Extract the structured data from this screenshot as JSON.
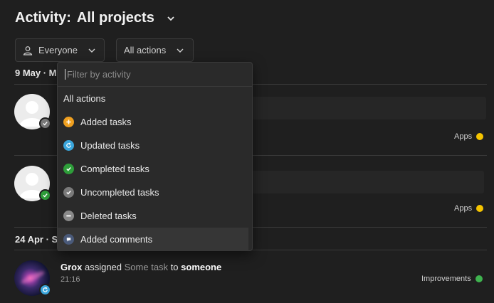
{
  "header": {
    "title_prefix": "Activity:",
    "title_scope": "All projects"
  },
  "filters": {
    "people_label": "Everyone",
    "actions_label": "All actions"
  },
  "sections": [
    {
      "date": "9 May · M"
    },
    {
      "date": "24 Apr · S"
    }
  ],
  "entries": [
    {
      "tag": "Apps",
      "tag_color": "#f5c400"
    },
    {
      "tag": "Apps",
      "tag_color": "#f5c400"
    },
    {
      "user": "Grox",
      "verb": "assigned",
      "task": "Some task",
      "preposition": "to",
      "target": "someone",
      "time": "21:16",
      "tag": "Improvements",
      "tag_color": "#3fb34f"
    }
  ],
  "dropdown": {
    "search_placeholder": "Filter by activity",
    "items": [
      {
        "label": "All actions",
        "icon": "none"
      },
      {
        "label": "Added tasks",
        "icon": "plus-icon",
        "color": "#f0a020"
      },
      {
        "label": "Updated tasks",
        "icon": "refresh-icon",
        "color": "#3aa6dc"
      },
      {
        "label": "Completed tasks",
        "icon": "check-icon",
        "color": "#2e9e3a"
      },
      {
        "label": "Uncompleted tasks",
        "icon": "check-icon",
        "color": "#7a7a7a"
      },
      {
        "label": "Deleted tasks",
        "icon": "minus-icon",
        "color": "#8a8a8a"
      },
      {
        "label": "Added comments",
        "icon": "comment-icon",
        "color": "#4a5a7a"
      }
    ]
  }
}
